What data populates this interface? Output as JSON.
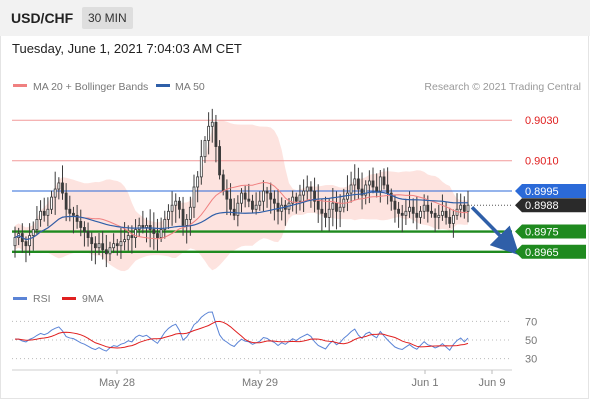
{
  "header": {
    "symbol": "USD/CHF",
    "timeframe": "30 MIN",
    "timestamp": "Tuesday, June 1, 2021 7:04:03 AM CET"
  },
  "legend": {
    "bollinger": "MA 20 + Bollinger Bands",
    "ma50": "MA 50",
    "copyright": "Research © 2021 Trading Central",
    "rsi": "RSI",
    "ma9": "9MA"
  },
  "colors": {
    "candle": "#3a3a3a",
    "bollinger": "#f08080",
    "band_fill": "#fde0dc",
    "ma50": "#2f5fa8",
    "resistance": "#f29a9a",
    "resistance_text": "#e02020",
    "pivot": "#2b6ad8",
    "support": "#1f8a1f",
    "last": "#2a2a2a",
    "rsi": "#5b84d6",
    "rsi_ma": "#e02020",
    "arrow": "#2f5fa8"
  },
  "chart_data": [
    {
      "type": "candlestick",
      "title": "USD/CHF 30 MIN",
      "x_ticks": [
        "May 28",
        "May 29",
        "Jun 1",
        "Jun 9"
      ],
      "y_range": [
        0.8955,
        0.904
      ],
      "levels": {
        "resistance": [
          "0.9030",
          "0.9010"
        ],
        "pivot": "0.8995",
        "last": "0.8988",
        "support": [
          "0.8975",
          "0.8965"
        ]
      },
      "projected_path": [
        0.8988,
        0.8965
      ],
      "close_series": [
        0.8972,
        0.8974,
        0.897,
        0.8968,
        0.8973,
        0.8976,
        0.8981,
        0.8985,
        0.8983,
        0.8986,
        0.8992,
        0.8996,
        0.8999,
        0.8994,
        0.8986,
        0.8984,
        0.8983,
        0.898,
        0.8977,
        0.8975,
        0.8972,
        0.8969,
        0.8967,
        0.8969,
        0.8966,
        0.8964,
        0.8967,
        0.8969,
        0.8968,
        0.897,
        0.8971,
        0.8973,
        0.8972,
        0.8976,
        0.8978,
        0.8977,
        0.8978,
        0.8976,
        0.8974,
        0.8972,
        0.8976,
        0.8981,
        0.8985,
        0.8988,
        0.899,
        0.8986,
        0.8978,
        0.8981,
        0.8987,
        0.8997,
        0.9002,
        0.9012,
        0.902,
        0.9027,
        0.9029,
        0.9017,
        0.9003,
        0.8995,
        0.8991,
        0.8986,
        0.8983,
        0.8989,
        0.8994,
        0.8991,
        0.899,
        0.8986,
        0.8988,
        0.899,
        0.8995,
        0.8994,
        0.8991,
        0.8989,
        0.8985,
        0.8988,
        0.8986,
        0.8989,
        0.8992,
        0.899,
        0.8993,
        0.8995,
        0.8997,
        0.8995,
        0.899,
        0.8986,
        0.8984,
        0.8982,
        0.8986,
        0.8989,
        0.8985,
        0.8987,
        0.8991,
        0.8994,
        0.8998,
        0.9001,
        0.8996,
        0.8993,
        0.8998,
        0.9,
        0.8997,
        0.8995,
        0.9002,
        0.8998,
        0.8994,
        0.899,
        0.8986,
        0.8984,
        0.8983,
        0.8985,
        0.8987,
        0.8984,
        0.8982,
        0.8985,
        0.8988,
        0.8985,
        0.8984,
        0.8982,
        0.8983,
        0.8985,
        0.8982,
        0.8979,
        0.8983,
        0.8986,
        0.8988,
        0.8985,
        0.8988
      ],
      "ohlc_sample": {
        "open": 0.8985,
        "high": 0.899,
        "low": 0.8983,
        "close": 0.8988
      }
    },
    {
      "type": "line",
      "title": "RSI",
      "series": [
        {
          "name": "RSI"
        },
        {
          "name": "9MA"
        }
      ],
      "y_ticks": [
        "70",
        "50",
        "30"
      ],
      "y_range": [
        20,
        80
      ]
    }
  ]
}
